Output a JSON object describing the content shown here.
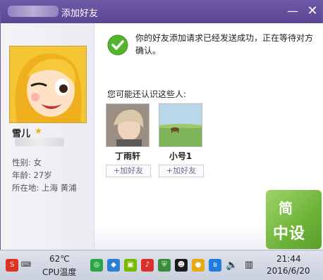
{
  "window": {
    "title": "添加好友",
    "min_symbol": "—",
    "close_symbol": "✕"
  },
  "profile": {
    "nickname": "雪儿",
    "info": [
      "性别: 女",
      "年龄: 27岁",
      "所在地: 上海  黄浦"
    ]
  },
  "main": {
    "message": "你的好友添加请求已经发送成功，正在等待对方确认。",
    "section_title": "您可能还认识这些人:",
    "suggestions": [
      {
        "name": "丁雨轩",
        "button": "+加好友"
      },
      {
        "name": "小号1",
        "button": "+加好友"
      }
    ]
  },
  "taskbar": {
    "cpu_temp": "62℃",
    "cpu_label": "CPU温度",
    "time": "21:44",
    "date": "2016/6/20"
  },
  "watermark": {
    "line1": "简",
    "line2": "中设"
  }
}
